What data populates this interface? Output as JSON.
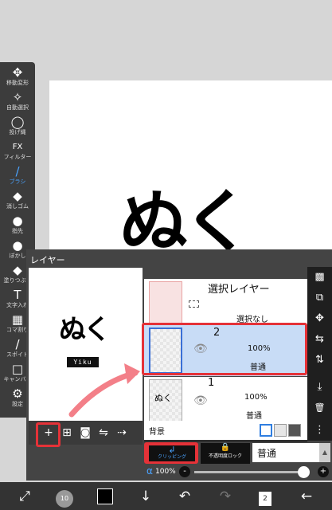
{
  "canvas": {
    "text": "ぬく"
  },
  "tools": [
    {
      "icon": "move-transform-icon",
      "glyph": "✥",
      "label": "移動変形"
    },
    {
      "icon": "magic-wand-icon",
      "glyph": "✧",
      "label": "自動選択"
    },
    {
      "icon": "lasso-icon",
      "glyph": "◯",
      "label": "投げ縄"
    },
    {
      "icon": "fx-filter-icon",
      "glyph": "FX",
      "label": "フィルター"
    },
    {
      "icon": "brush-icon",
      "glyph": "/",
      "label": "ブラシ"
    },
    {
      "icon": "eraser-icon",
      "glyph": "◆",
      "label": "消しゴム"
    },
    {
      "icon": "smudge-icon",
      "glyph": "●",
      "label": "指先"
    },
    {
      "icon": "blur-icon",
      "glyph": "●",
      "label": "ぼかし"
    },
    {
      "icon": "fill-bucket-icon",
      "glyph": "◆",
      "label": "塗りつぶし"
    },
    {
      "icon": "text-tool-icon",
      "glyph": "T",
      "label": "文字入れ"
    },
    {
      "icon": "frame-divider-icon",
      "glyph": "▦",
      "label": "コマ割り"
    },
    {
      "icon": "eyedropper-icon",
      "glyph": "/",
      "label": "スポイト"
    },
    {
      "icon": "canvas-icon",
      "glyph": "□",
      "label": "キャンバス"
    },
    {
      "icon": "settings-gear-icon",
      "glyph": "⚙",
      "label": "設定"
    }
  ],
  "layer_window": {
    "title": "レイヤー",
    "preview": {
      "text": "ぬく",
      "tag": "Yiku"
    },
    "preview_buttons": [
      {
        "icon": "add-layer-icon",
        "glyph": "+"
      },
      {
        "icon": "add-special-layer-icon",
        "glyph": "⊞"
      },
      {
        "icon": "camera-import-icon",
        "glyph": "◙"
      },
      {
        "icon": "flip-layer-icon",
        "glyph": "⇋"
      },
      {
        "icon": "layer-menu-icon",
        "glyph": "⇢"
      }
    ],
    "selection_layer": {
      "name": "選択レイヤー",
      "status": "選択なし"
    },
    "layers": [
      {
        "name": "2",
        "opacity": "100%",
        "blend": "普通",
        "selected": true
      },
      {
        "name": "1",
        "opacity": "100%",
        "blend": "普通",
        "selected": false
      }
    ],
    "background_label": "背景",
    "right_tools": [
      {
        "icon": "checkerboard-icon",
        "glyph": "▩"
      },
      {
        "icon": "layer-transfer-icon",
        "glyph": "⧉"
      },
      {
        "icon": "move-layer-icon",
        "glyph": "✥"
      },
      {
        "icon": "flip-horizontal-icon",
        "glyph": "⇆"
      },
      {
        "icon": "flip-vertical-icon",
        "glyph": "⇅"
      },
      {
        "icon": "merge-down-icon",
        "glyph": "⤓"
      },
      {
        "icon": "delete-layer-icon",
        "glyph": "🗑"
      },
      {
        "icon": "more-menu-icon",
        "glyph": "⋮"
      }
    ],
    "clipping_label": "クリッピング",
    "alpha_lock_label": "不透明度ロック",
    "blend_mode": "普通",
    "alpha_label": "α",
    "alpha_value": "100%",
    "alpha_fraction": 1.0
  },
  "bottom_bar": {
    "brush_size": "10",
    "page_count": "2",
    "primary_color": "#000000"
  },
  "colors": {
    "accent": "#4aa3ff",
    "highlight": "#e53238",
    "selected_row": "#c8dcf6"
  }
}
